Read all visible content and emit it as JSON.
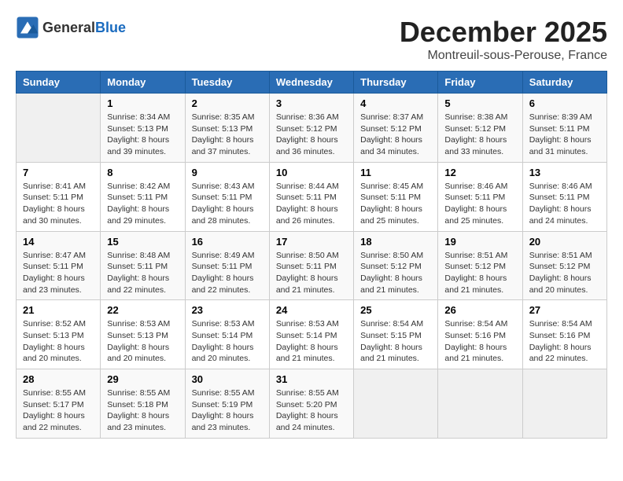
{
  "header": {
    "logo_general": "General",
    "logo_blue": "Blue",
    "title": "December 2025",
    "subtitle": "Montreuil-sous-Perouse, France"
  },
  "weekdays": [
    "Sunday",
    "Monday",
    "Tuesday",
    "Wednesday",
    "Thursday",
    "Friday",
    "Saturday"
  ],
  "weeks": [
    [
      {
        "day": "",
        "empty": true
      },
      {
        "day": "1",
        "sunrise": "Sunrise: 8:34 AM",
        "sunset": "Sunset: 5:13 PM",
        "daylight": "Daylight: 8 hours and 39 minutes."
      },
      {
        "day": "2",
        "sunrise": "Sunrise: 8:35 AM",
        "sunset": "Sunset: 5:13 PM",
        "daylight": "Daylight: 8 hours and 37 minutes."
      },
      {
        "day": "3",
        "sunrise": "Sunrise: 8:36 AM",
        "sunset": "Sunset: 5:12 PM",
        "daylight": "Daylight: 8 hours and 36 minutes."
      },
      {
        "day": "4",
        "sunrise": "Sunrise: 8:37 AM",
        "sunset": "Sunset: 5:12 PM",
        "daylight": "Daylight: 8 hours and 34 minutes."
      },
      {
        "day": "5",
        "sunrise": "Sunrise: 8:38 AM",
        "sunset": "Sunset: 5:12 PM",
        "daylight": "Daylight: 8 hours and 33 minutes."
      },
      {
        "day": "6",
        "sunrise": "Sunrise: 8:39 AM",
        "sunset": "Sunset: 5:11 PM",
        "daylight": "Daylight: 8 hours and 31 minutes."
      }
    ],
    [
      {
        "day": "7",
        "sunrise": "Sunrise: 8:41 AM",
        "sunset": "Sunset: 5:11 PM",
        "daylight": "Daylight: 8 hours and 30 minutes."
      },
      {
        "day": "8",
        "sunrise": "Sunrise: 8:42 AM",
        "sunset": "Sunset: 5:11 PM",
        "daylight": "Daylight: 8 hours and 29 minutes."
      },
      {
        "day": "9",
        "sunrise": "Sunrise: 8:43 AM",
        "sunset": "Sunset: 5:11 PM",
        "daylight": "Daylight: 8 hours and 28 minutes."
      },
      {
        "day": "10",
        "sunrise": "Sunrise: 8:44 AM",
        "sunset": "Sunset: 5:11 PM",
        "daylight": "Daylight: 8 hours and 26 minutes."
      },
      {
        "day": "11",
        "sunrise": "Sunrise: 8:45 AM",
        "sunset": "Sunset: 5:11 PM",
        "daylight": "Daylight: 8 hours and 25 minutes."
      },
      {
        "day": "12",
        "sunrise": "Sunrise: 8:46 AM",
        "sunset": "Sunset: 5:11 PM",
        "daylight": "Daylight: 8 hours and 25 minutes."
      },
      {
        "day": "13",
        "sunrise": "Sunrise: 8:46 AM",
        "sunset": "Sunset: 5:11 PM",
        "daylight": "Daylight: 8 hours and 24 minutes."
      }
    ],
    [
      {
        "day": "14",
        "sunrise": "Sunrise: 8:47 AM",
        "sunset": "Sunset: 5:11 PM",
        "daylight": "Daylight: 8 hours and 23 minutes."
      },
      {
        "day": "15",
        "sunrise": "Sunrise: 8:48 AM",
        "sunset": "Sunset: 5:11 PM",
        "daylight": "Daylight: 8 hours and 22 minutes."
      },
      {
        "day": "16",
        "sunrise": "Sunrise: 8:49 AM",
        "sunset": "Sunset: 5:11 PM",
        "daylight": "Daylight: 8 hours and 22 minutes."
      },
      {
        "day": "17",
        "sunrise": "Sunrise: 8:50 AM",
        "sunset": "Sunset: 5:11 PM",
        "daylight": "Daylight: 8 hours and 21 minutes."
      },
      {
        "day": "18",
        "sunrise": "Sunrise: 8:50 AM",
        "sunset": "Sunset: 5:12 PM",
        "daylight": "Daylight: 8 hours and 21 minutes."
      },
      {
        "day": "19",
        "sunrise": "Sunrise: 8:51 AM",
        "sunset": "Sunset: 5:12 PM",
        "daylight": "Daylight: 8 hours and 21 minutes."
      },
      {
        "day": "20",
        "sunrise": "Sunrise: 8:51 AM",
        "sunset": "Sunset: 5:12 PM",
        "daylight": "Daylight: 8 hours and 20 minutes."
      }
    ],
    [
      {
        "day": "21",
        "sunrise": "Sunrise: 8:52 AM",
        "sunset": "Sunset: 5:13 PM",
        "daylight": "Daylight: 8 hours and 20 minutes."
      },
      {
        "day": "22",
        "sunrise": "Sunrise: 8:53 AM",
        "sunset": "Sunset: 5:13 PM",
        "daylight": "Daylight: 8 hours and 20 minutes."
      },
      {
        "day": "23",
        "sunrise": "Sunrise: 8:53 AM",
        "sunset": "Sunset: 5:14 PM",
        "daylight": "Daylight: 8 hours and 20 minutes."
      },
      {
        "day": "24",
        "sunrise": "Sunrise: 8:53 AM",
        "sunset": "Sunset: 5:14 PM",
        "daylight": "Daylight: 8 hours and 21 minutes."
      },
      {
        "day": "25",
        "sunrise": "Sunrise: 8:54 AM",
        "sunset": "Sunset: 5:15 PM",
        "daylight": "Daylight: 8 hours and 21 minutes."
      },
      {
        "day": "26",
        "sunrise": "Sunrise: 8:54 AM",
        "sunset": "Sunset: 5:16 PM",
        "daylight": "Daylight: 8 hours and 21 minutes."
      },
      {
        "day": "27",
        "sunrise": "Sunrise: 8:54 AM",
        "sunset": "Sunset: 5:16 PM",
        "daylight": "Daylight: 8 hours and 22 minutes."
      }
    ],
    [
      {
        "day": "28",
        "sunrise": "Sunrise: 8:55 AM",
        "sunset": "Sunset: 5:17 PM",
        "daylight": "Daylight: 8 hours and 22 minutes."
      },
      {
        "day": "29",
        "sunrise": "Sunrise: 8:55 AM",
        "sunset": "Sunset: 5:18 PM",
        "daylight": "Daylight: 8 hours and 23 minutes."
      },
      {
        "day": "30",
        "sunrise": "Sunrise: 8:55 AM",
        "sunset": "Sunset: 5:19 PM",
        "daylight": "Daylight: 8 hours and 23 minutes."
      },
      {
        "day": "31",
        "sunrise": "Sunrise: 8:55 AM",
        "sunset": "Sunset: 5:20 PM",
        "daylight": "Daylight: 8 hours and 24 minutes."
      },
      {
        "day": "",
        "empty": true
      },
      {
        "day": "",
        "empty": true
      },
      {
        "day": "",
        "empty": true
      }
    ]
  ]
}
